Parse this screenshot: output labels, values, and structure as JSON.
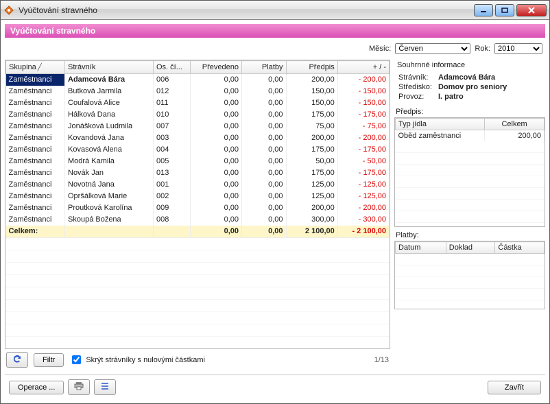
{
  "window": {
    "title": "Vyúčtování stravného"
  },
  "section": {
    "title": "Vyúčtování stravného"
  },
  "filters": {
    "month_label": "Měsíc:",
    "month_value": "Červen",
    "year_label": "Rok:",
    "year_value": "2010"
  },
  "columns": {
    "skupina": "Skupina",
    "stravnik": "Strávník",
    "oscislo": "Os. čí...",
    "prevedeno": "Převedeno",
    "platby": "Platby",
    "predpis": "Předpis",
    "rozdil": "+ / -"
  },
  "rows": [
    {
      "skupina": "Zaměstnanci",
      "stravnik": "Adamcová Bára",
      "os": "006",
      "prev": "0,00",
      "plat": "0,00",
      "pred": "200,00",
      "diff": "- 200,00",
      "selected": true
    },
    {
      "skupina": "Zaměstnanci",
      "stravnik": "Butková Jarmila",
      "os": "012",
      "prev": "0,00",
      "plat": "0,00",
      "pred": "150,00",
      "diff": "- 150,00"
    },
    {
      "skupina": "Zaměstnanci",
      "stravnik": "Coufalová Alice",
      "os": "011",
      "prev": "0,00",
      "plat": "0,00",
      "pred": "150,00",
      "diff": "- 150,00"
    },
    {
      "skupina": "Zaměstnanci",
      "stravnik": "Hálková Dana",
      "os": "010",
      "prev": "0,00",
      "plat": "0,00",
      "pred": "175,00",
      "diff": "- 175,00"
    },
    {
      "skupina": "Zaměstnanci",
      "stravnik": "Jonášková Ludmila",
      "os": "007",
      "prev": "0,00",
      "plat": "0,00",
      "pred": "75,00",
      "diff": "- 75,00"
    },
    {
      "skupina": "Zaměstnanci",
      "stravnik": "Kovandová Jana",
      "os": "003",
      "prev": "0,00",
      "plat": "0,00",
      "pred": "200,00",
      "diff": "- 200,00"
    },
    {
      "skupina": "Zaměstnanci",
      "stravnik": "Kovasová Alena",
      "os": "004",
      "prev": "0,00",
      "plat": "0,00",
      "pred": "175,00",
      "diff": "- 175,00"
    },
    {
      "skupina": "Zaměstnanci",
      "stravnik": "Modrá Kamila",
      "os": "005",
      "prev": "0,00",
      "plat": "0,00",
      "pred": "50,00",
      "diff": "- 50,00"
    },
    {
      "skupina": "Zaměstnanci",
      "stravnik": "Novák Jan",
      "os": "013",
      "prev": "0,00",
      "plat": "0,00",
      "pred": "175,00",
      "diff": "- 175,00"
    },
    {
      "skupina": "Zaměstnanci",
      "stravnik": "Novotná Jana",
      "os": "001",
      "prev": "0,00",
      "plat": "0,00",
      "pred": "125,00",
      "diff": "- 125,00"
    },
    {
      "skupina": "Zaměstnanci",
      "stravnik": "Opršálková Marie",
      "os": "002",
      "prev": "0,00",
      "plat": "0,00",
      "pred": "125,00",
      "diff": "- 125,00"
    },
    {
      "skupina": "Zaměstnanci",
      "stravnik": "Proutková Karolína",
      "os": "009",
      "prev": "0,00",
      "plat": "0,00",
      "pred": "200,00",
      "diff": "- 200,00"
    },
    {
      "skupina": "Zaměstnanci",
      "stravnik": "Skoupá Božena",
      "os": "008",
      "prev": "0,00",
      "plat": "0,00",
      "pred": "300,00",
      "diff": "- 300,00"
    }
  ],
  "total": {
    "label": "Celkem:",
    "prev": "0,00",
    "plat": "0,00",
    "pred": "2 100,00",
    "diff": "- 2 100,00"
  },
  "footer": {
    "refresh": "↻",
    "filter": "Filtr",
    "hide_zero": "Skrýt strávníky s nulovými částkami",
    "hide_zero_checked": true,
    "page": "1/13"
  },
  "summary": {
    "title": "Souhrnné informace",
    "stravnik_label": "Strávník:",
    "stravnik_value": "Adamcová Bára",
    "stredisko_label": "Středisko:",
    "stredisko_value": "Domov pro seniory",
    "provoz_label": "Provoz:",
    "provoz_value": "I. patro"
  },
  "predpis_panel": {
    "title": "Předpis:",
    "col_typ": "Typ jídla",
    "col_celkem": "Celkem",
    "rows": [
      {
        "typ": "Oběd zaměstnanci",
        "celkem": "200,00"
      }
    ]
  },
  "platby_panel": {
    "title": "Platby:",
    "col_datum": "Datum",
    "col_doklad": "Doklad",
    "col_castka": "Částka"
  },
  "bottom": {
    "operace": "Operace ...",
    "zavrit": "Zavřít"
  }
}
